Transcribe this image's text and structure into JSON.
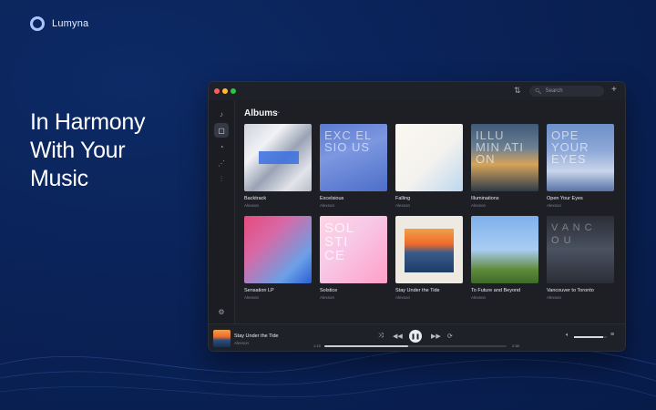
{
  "brand": {
    "name": "Lumyna"
  },
  "hero": {
    "line1": "In Harmony",
    "line2": "With Your",
    "line3": "Music"
  },
  "window": {
    "search_placeholder": "Search",
    "sidebar": [
      "music-note-icon",
      "album-icon",
      "artist-icon",
      "playlist-icon",
      "equalizer-icon",
      "settings-icon"
    ],
    "section_title": "Albums"
  },
  "albums": [
    {
      "title": "Backtrack",
      "artist": "Alexson",
      "cover_text": ""
    },
    {
      "title": "Excelsious",
      "artist": "Alexson",
      "cover_text": "EXC EL SIO US"
    },
    {
      "title": "Falling",
      "artist": "Alexson",
      "cover_text": ""
    },
    {
      "title": "Illuminations",
      "artist": "Alexson",
      "cover_text": "ILLU MIN ATI ON"
    },
    {
      "title": "Open Your Eyes",
      "artist": "Alexson",
      "cover_text": "OPE YOUR EYES"
    },
    {
      "title": "Sensation LP",
      "artist": "Alexson",
      "cover_text": ""
    },
    {
      "title": "Solstice",
      "artist": "Alexson",
      "cover_text": "SOL STI CE"
    },
    {
      "title": "Stay Under the Tide",
      "artist": "Alexson",
      "cover_text": ""
    },
    {
      "title": "To Future and Beyond",
      "artist": "Alexson",
      "cover_text": ""
    },
    {
      "title": "Vancouver to Toronto",
      "artist": "Alexson",
      "cover_text": "V A N C O U"
    }
  ],
  "player": {
    "title": "Stay Under the Tide",
    "artist": "Alexson",
    "elapsed": "1:13",
    "duration": "2:38",
    "progress": 0.46,
    "volume": 0.9
  },
  "colors": {
    "background": "#0a2257",
    "window": "#1d1f25",
    "accent": "#3b6fe0"
  }
}
